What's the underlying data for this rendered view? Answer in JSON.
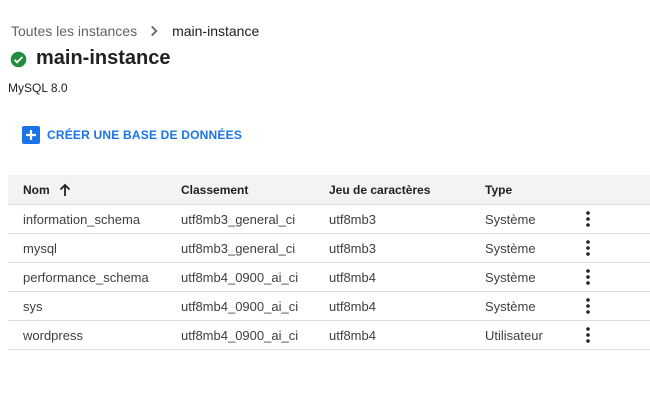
{
  "breadcrumb": {
    "parent": "Toutes les instances",
    "current": "main-instance"
  },
  "header": {
    "title": "main-instance",
    "version": "MySQL 8.0",
    "status_color": "#1e8e3e"
  },
  "actions": {
    "create_label": "CRÉER UNE BASE DE DONNÉES",
    "accent_color": "#1a73e8"
  },
  "table": {
    "columns": [
      "Nom",
      "Classement",
      "Jeu de caractères",
      "Type"
    ],
    "rows": [
      {
        "name": "information_schema",
        "collation": "utf8mb3_general_ci",
        "charset": "utf8mb3",
        "type": "Système"
      },
      {
        "name": "mysql",
        "collation": "utf8mb3_general_ci",
        "charset": "utf8mb3",
        "type": "Système"
      },
      {
        "name": "performance_schema",
        "collation": "utf8mb4_0900_ai_ci",
        "charset": "utf8mb4",
        "type": "Système"
      },
      {
        "name": "sys",
        "collation": "utf8mb4_0900_ai_ci",
        "charset": "utf8mb4",
        "type": "Système"
      },
      {
        "name": "wordpress",
        "collation": "utf8mb4_0900_ai_ci",
        "charset": "utf8mb4",
        "type": "Utilisateur"
      }
    ]
  }
}
